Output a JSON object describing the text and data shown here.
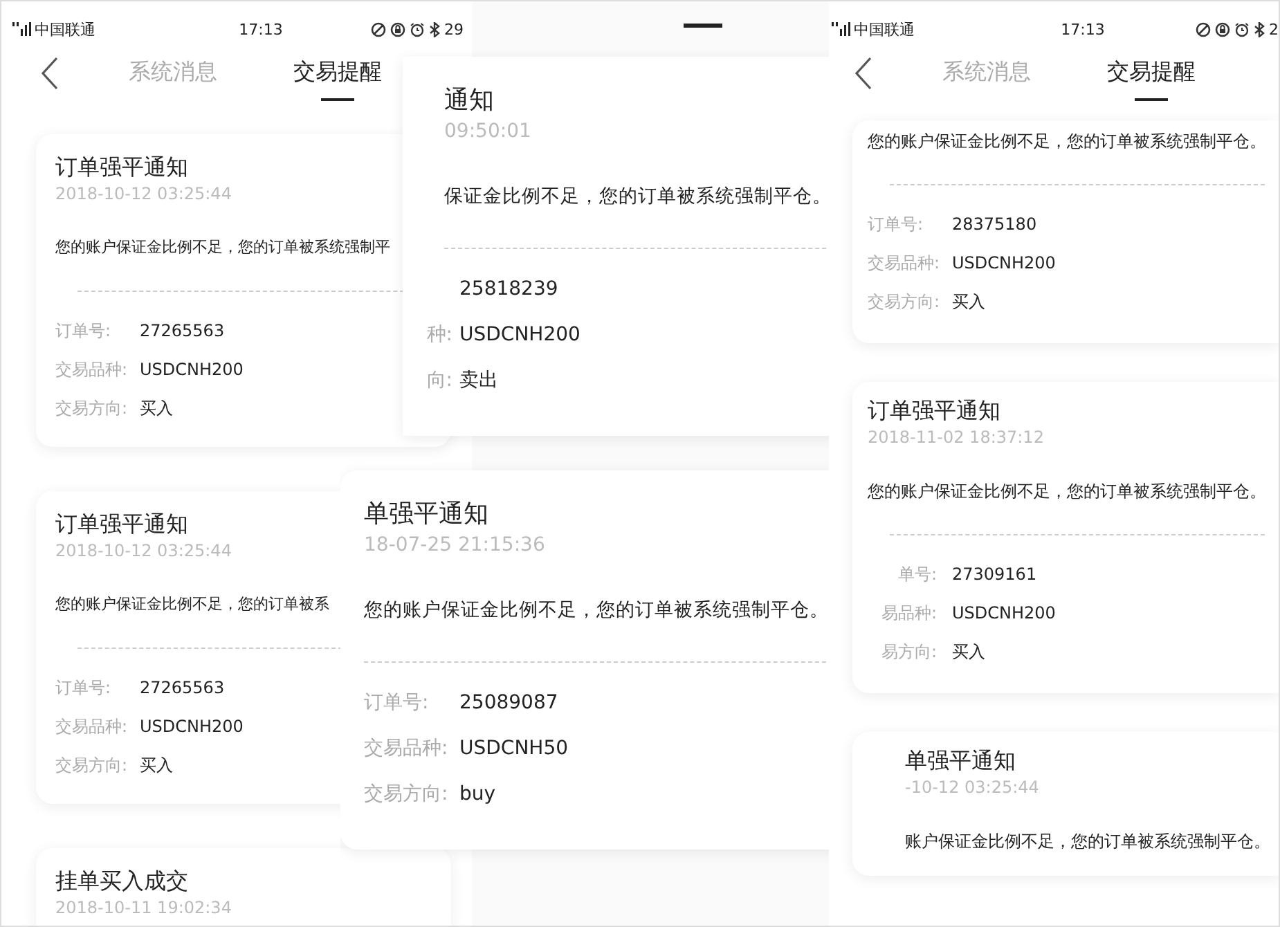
{
  "panels": [
    {
      "status_bar": {
        "carrier": "中国联通",
        "time": "17:13",
        "battery": "29"
      },
      "nav": {
        "tabs": [
          {
            "label": "系统消息",
            "selected": false
          },
          {
            "label": "交易提醒",
            "selected": true
          }
        ]
      },
      "cards": [
        {
          "title": "订单强平通知",
          "time": "2018-10-12 03:25:44",
          "message": "您的账户保证金比例不足，您的订单被系统强制平",
          "fields": [
            {
              "label": "订单号:",
              "value": "27265563"
            },
            {
              "label": "交易品种:",
              "value": "USDCNH200"
            },
            {
              "label": "交易方向:",
              "value": "买入"
            }
          ]
        },
        {
          "title": "订单强平通知",
          "time": "2018-10-12 03:25:44",
          "message": "您的账户保证金比例不足，您的订单被系",
          "fields": [
            {
              "label": "订单号:",
              "value": "27265563"
            },
            {
              "label": "交易品种:",
              "value": "USDCNH200"
            },
            {
              "label": "交易方向:",
              "value": "买入"
            }
          ]
        },
        {
          "title": "挂单买入成交",
          "time": "2018-10-11 19:02:34"
        }
      ]
    },
    {
      "home_indicator": true,
      "cards": [
        {
          "title": "通知",
          "time": "09:50:01",
          "message": "保证金比例不足，您的订单被系统强制平仓。",
          "fields": [
            {
              "value": "25818239"
            },
            {
              "label": "种:",
              "value": "USDCNH200"
            },
            {
              "label": "向:",
              "value": "卖出"
            }
          ]
        },
        {
          "title": "单强平通知",
          "time": "18-07-25 21:15:36",
          "message": "您的账户保证金比例不足，您的订单被系统强制平仓。",
          "fields": [
            {
              "label": "订单号:",
              "value": "25089087"
            },
            {
              "label": "交易品种:",
              "value": "USDCNH50"
            },
            {
              "label": "交易方向:",
              "value": "buy"
            }
          ]
        }
      ]
    },
    {
      "status_bar": {
        "carrier": "中国联通",
        "time": "17:13",
        "battery": "2"
      },
      "nav": {
        "tabs": [
          {
            "label": "系统消息",
            "selected": false
          },
          {
            "label": "交易提醒",
            "selected": true
          }
        ]
      },
      "cards": [
        {
          "message": "您的账户保证金比例不足，您的订单被系统强制平仓。",
          "fields": [
            {
              "label": "订单号:",
              "value": "28375180"
            },
            {
              "label": "交易品种:",
              "value": "USDCNH200"
            },
            {
              "label": "交易方向:",
              "value": "买入"
            }
          ]
        },
        {
          "title": "订单强平通知",
          "time": "2018-11-02 18:37:12",
          "message": "您的账户保证金比例不足，您的订单被系统强制平仓。",
          "fields": [
            {
              "label": "单号:",
              "value": "27309161"
            },
            {
              "label": "易品种:",
              "value": "USDCNH200"
            },
            {
              "label": "易方向:",
              "value": "买入"
            }
          ]
        },
        {
          "title": "单强平通知",
          "time": "-10-12 03:25:44",
          "message": "账户保证金比例不足，您的订单被系统强制平仓。"
        }
      ]
    }
  ]
}
